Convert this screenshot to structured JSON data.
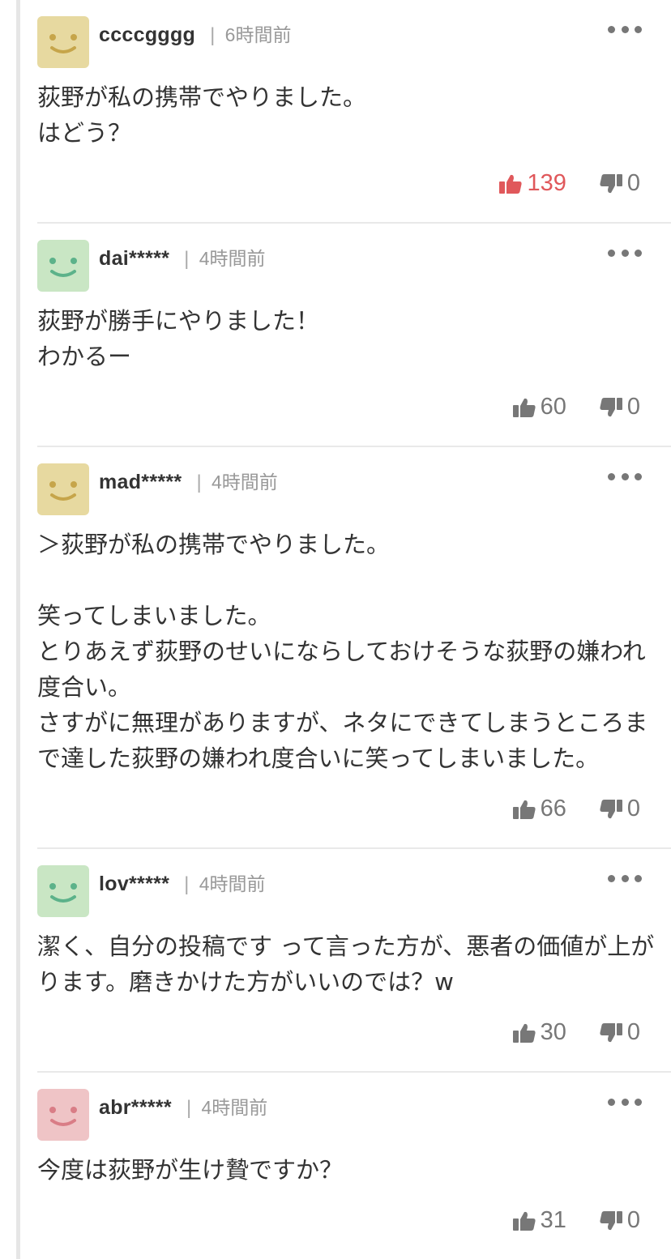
{
  "comments": [
    {
      "user": "ccccgggg",
      "separator": "|",
      "time": "6時間前",
      "body": "荻野が私の携帯でやりました。\nはどう？",
      "likes": "139",
      "dislikes": "0",
      "avatar_color": "#e7d9a0",
      "face_color": "#c6a54a",
      "liked": true
    },
    {
      "user": "dai*****",
      "separator": "|",
      "time": "4時間前",
      "body": "荻野が勝手にやりました！\nわかるー",
      "likes": "60",
      "dislikes": "0",
      "avatar_color": "#c9e6c4",
      "face_color": "#5cb28a",
      "liked": false
    },
    {
      "user": "mad*****",
      "separator": "|",
      "time": "4時間前",
      "body": "＞荻野が私の携帯でやりました。\n\n笑ってしまいました。\nとりあえず荻野のせいにならしておけそうな荻野の嫌われ度合い。\nさすがに無理がありますが、ネタにできてしまうところまで達した荻野の嫌われ度合いに笑ってしまいました。",
      "likes": "66",
      "dislikes": "0",
      "avatar_color": "#e7d9a0",
      "face_color": "#c6a54a",
      "liked": false
    },
    {
      "user": "lov*****",
      "separator": "|",
      "time": "4時間前",
      "body": "潔く、自分の投稿です って言った方が、悪者の価値が上がります。磨きかけた方がいいのでは？w",
      "likes": "30",
      "dislikes": "0",
      "avatar_color": "#c9e6c4",
      "face_color": "#5cb28a",
      "liked": false
    },
    {
      "user": "abr*****",
      "separator": "|",
      "time": "4時間前",
      "body": "今度は荻野が生け贄ですか？",
      "likes": "31",
      "dislikes": "0",
      "avatar_color": "#efc4c6",
      "face_color": "#d97d86",
      "liked": false
    }
  ]
}
